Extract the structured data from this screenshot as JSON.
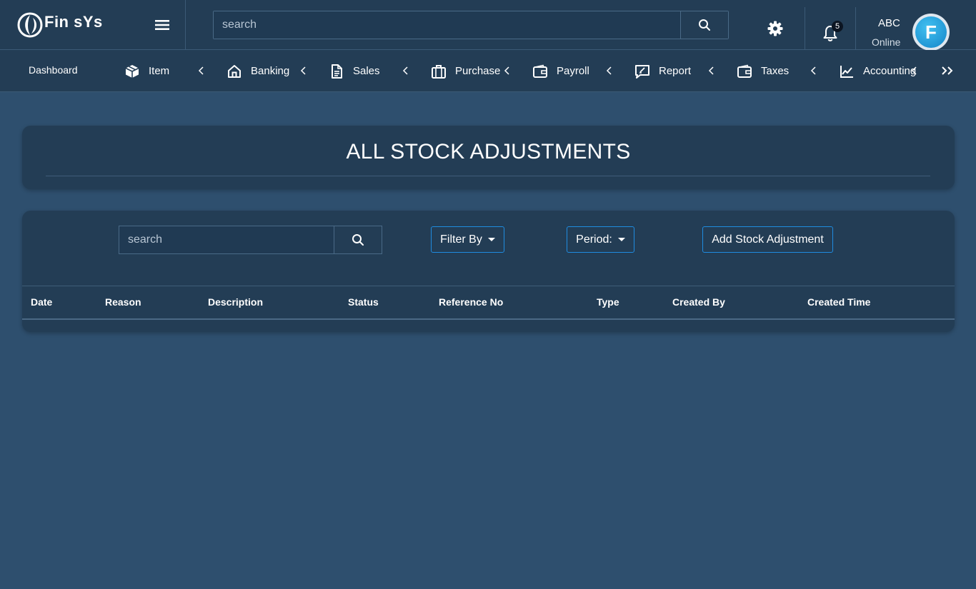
{
  "app": {
    "name": "Fin sYs"
  },
  "header": {
    "search_placeholder": "search",
    "notifications_count": "5",
    "user_name": "ABC",
    "user_status": "Online",
    "avatar_letter": "F"
  },
  "nav": {
    "dashboard": "Dashboard",
    "items": [
      {
        "label": "Item",
        "icon": "box-icon"
      },
      {
        "label": "Banking",
        "icon": "home-icon"
      },
      {
        "label": "Sales",
        "icon": "document-icon"
      },
      {
        "label": "Purchase",
        "icon": "briefcase-icon"
      },
      {
        "label": "Payroll",
        "icon": "wallet-icon"
      },
      {
        "label": "Report",
        "icon": "report-icon"
      },
      {
        "label": "Taxes",
        "icon": "wallet-icon"
      },
      {
        "label": "Accounting",
        "icon": "chart-line-icon"
      }
    ]
  },
  "page": {
    "title": "ALL STOCK ADJUSTMENTS"
  },
  "toolbar": {
    "search_placeholder": "search",
    "filter_label": "Filter By",
    "period_label": "Period:",
    "add_label": "Add Stock Adjustment"
  },
  "table": {
    "columns": [
      "Date",
      "Reason",
      "Description",
      "Status",
      "Reference No",
      "Type",
      "Created By",
      "Created Time"
    ],
    "rows": []
  },
  "colors": {
    "background": "#2e4f6e",
    "panel": "#233d55",
    "accent_border": "#1f8ce0",
    "avatar": "#1485c9"
  }
}
